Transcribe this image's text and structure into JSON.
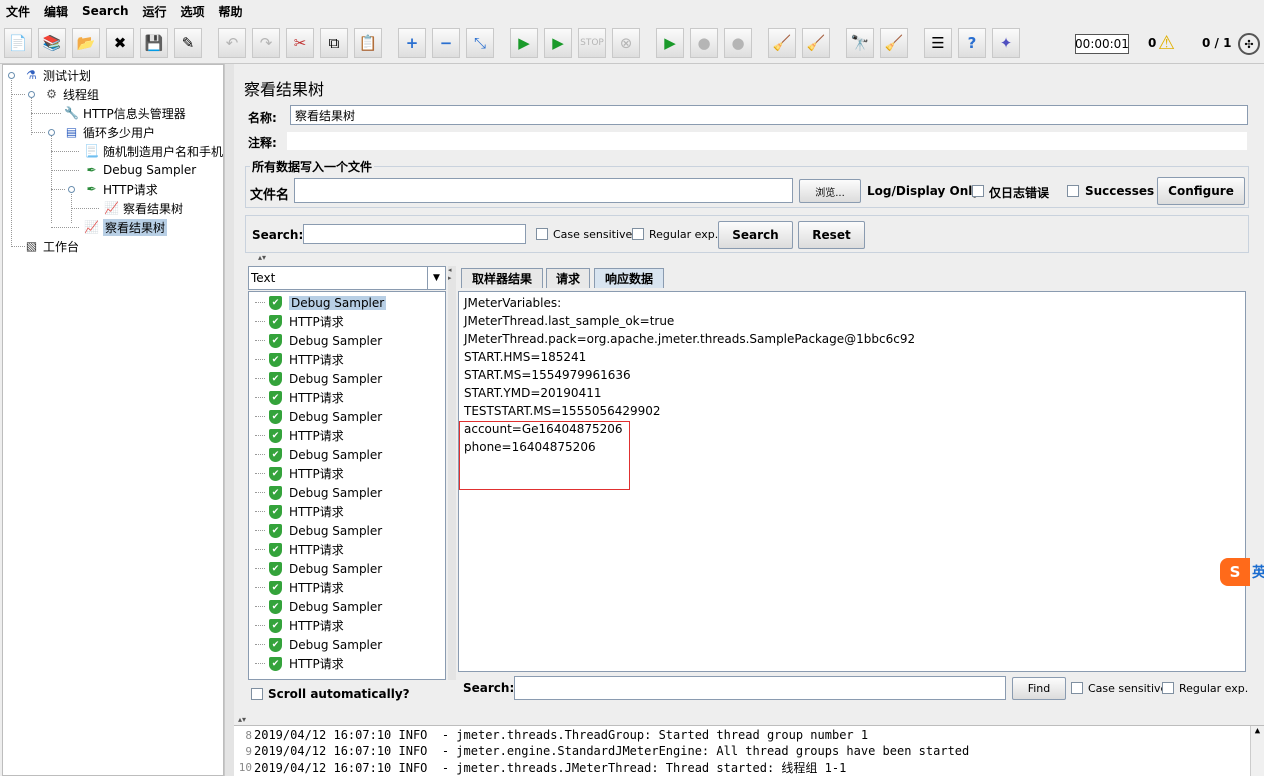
{
  "menu": [
    "文件",
    "编辑",
    "Search",
    "运行",
    "选项",
    "帮助"
  ],
  "toolbar": {
    "timer": "00:00:01",
    "error_count": "0",
    "thread_count": "0 / 1"
  },
  "tree": {
    "nodes": [
      {
        "label": "测试计划",
        "icon": "test-plan-icon"
      },
      {
        "label": "线程组",
        "icon": "thread-group-icon"
      },
      {
        "label": "HTTP信息头管理器",
        "icon": "wrench-icon"
      },
      {
        "label": "循环多少用户",
        "icon": "loop-controller-icon"
      },
      {
        "label": "随机制造用户名和手机",
        "icon": "script-icon"
      },
      {
        "label": "Debug Sampler",
        "icon": "pipette-icon"
      },
      {
        "label": "HTTP请求",
        "icon": "pipette-icon"
      },
      {
        "label": "察看结果树",
        "icon": "chart-icon"
      },
      {
        "label": "察看结果树",
        "icon": "chart-icon"
      },
      {
        "label": "工作台",
        "icon": "workbench-icon"
      }
    ]
  },
  "panel": {
    "title": "察看结果树",
    "name_label": "名称:",
    "name_value": "察看结果树",
    "comment_label": "注释:",
    "comment_value": "",
    "file_group_title": "所有数据写入一个文件",
    "file_label": "文件名",
    "file_value": "",
    "browse_label": "浏览...",
    "log_display_label": "Log/Display Only:",
    "errors_only_label": "仅日志错误",
    "successes_label": "Successes",
    "configure_label": "Configure"
  },
  "search": {
    "label": "Search:",
    "value": "",
    "case_sensitive_label": "Case sensitive",
    "regex_label": "Regular exp.",
    "search_button": "Search",
    "reset_button": "Reset"
  },
  "results": {
    "renderer": "Text",
    "items": [
      "Debug Sampler",
      "HTTP请求",
      "Debug Sampler",
      "HTTP请求",
      "Debug Sampler",
      "HTTP请求",
      "Debug Sampler",
      "HTTP请求",
      "Debug Sampler",
      "HTTP请求",
      "Debug Sampler",
      "HTTP请求",
      "Debug Sampler",
      "HTTP请求",
      "Debug Sampler",
      "HTTP请求",
      "Debug Sampler",
      "HTTP请求",
      "Debug Sampler",
      "HTTP请求"
    ],
    "scroll_auto_label": "Scroll automatically?"
  },
  "tabs": [
    "取样器结果",
    "请求",
    "响应数据"
  ],
  "response": {
    "lines": [
      "JMeterVariables:",
      "JMeterThread.last_sample_ok=true",
      "JMeterThread.pack=org.apache.jmeter.threads.SamplePackage@1bbc6c92",
      "START.HMS=185241",
      "START.MS=1554979961636",
      "START.YMD=20190411",
      "TESTSTART.MS=1555056429902",
      "account=Ge16404875206",
      "phone=16404875206"
    ],
    "find_label": "Search:",
    "find_value": "",
    "find_button": "Find",
    "case_sensitive_label": "Case sensitive",
    "regex_label": "Regular exp."
  },
  "log": {
    "lines": [
      {
        "num": "8",
        "text": "2019/04/12 16:07:10 INFO  - jmeter.threads.ThreadGroup: Started thread group number 1"
      },
      {
        "num": "9",
        "text": "2019/04/12 16:07:10 INFO  - jmeter.engine.StandardJMeterEngine: All thread groups have been started"
      },
      {
        "num": "10",
        "text": "2019/04/12 16:07:10 INFO  - jmeter.threads.JMeterThread: Thread started: 线程组 1-1"
      }
    ]
  },
  "ime": {
    "logo": "S",
    "mode": "英"
  }
}
